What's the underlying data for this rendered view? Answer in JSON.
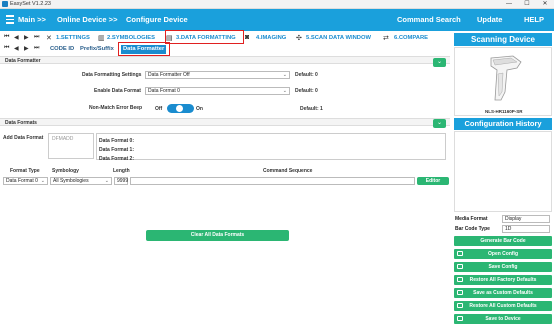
{
  "window": {
    "title": "EasySet V1.2.23",
    "minimize": "—",
    "maximize": "☐",
    "close": "✕"
  },
  "menu": {
    "main": "Main >>",
    "online_device": "Online Device >>",
    "configure_device": "Configure Device",
    "command_search": "Command Search",
    "update": "Update",
    "help": "HELP"
  },
  "tabs_row1": {
    "settings": "1.SETTINGS",
    "symbologies": "2.SYMBOLOGIES",
    "data_formatting": "3.DATA FORMATTING",
    "imaging": "4.IMAGING",
    "scan_data_window": "5.SCAN DATA WINDOW",
    "compare": "6.COMPARE"
  },
  "tabs_row2": {
    "code_id": "CODE ID",
    "prefix_suffix": "Prefix/Suffix",
    "data_formatter": "Data Formatter"
  },
  "data_formatter_section": {
    "header": "Data Formatter",
    "formatting_settings_label": "Data Formatting Settings",
    "formatting_settings_value": "Data Formatter Off",
    "formatting_default": "Default: 0",
    "enable_format_label": "Enable Data Format",
    "enable_format_value": "Data Format 0",
    "enable_default": "Default: 0",
    "non_match_label": "Non-Match Error Beep",
    "toggle_off": "Off",
    "toggle_on": "On",
    "non_match_default": "Default: 1"
  },
  "data_formats_section": {
    "header": "Data Formats",
    "add_label": "Add Data Format",
    "add_placeholder": "DFMADD",
    "formats": [
      "Data Format 0:",
      "Data Format 1:",
      "Data Format 2:"
    ],
    "col_format_type": "Format Type",
    "col_symbology": "Symbology",
    "col_length": "Length",
    "col_command_sequence": "Command Sequence",
    "format_type_value": "Data Format 0",
    "symbology_value": "All Symbologies",
    "length_value": "9999",
    "command_sequence_value": "",
    "editor_button": "Editor",
    "clear_button": "Clear All Data Formats"
  },
  "right_panel": {
    "scanning_device_title": "Scanning Device",
    "device_model": "NLS-HR1160P-SR",
    "config_history_title": "Configuration History",
    "media_format_label": "Media Format",
    "media_format_value": "Display",
    "bar_code_type_label": "Bar Code Type",
    "bar_code_type_value": "1D",
    "generate_button": "Generate Bar Code",
    "buttons": [
      "Open Config",
      "Save Config",
      "Restore All Factory Defaults",
      "Save as Custom Defaults",
      "Restore All Custom Defaults",
      "Save to Device"
    ]
  },
  "colors": {
    "accent": "#1aa0dc",
    "green": "#2bb673",
    "highlight": "#e02020"
  }
}
